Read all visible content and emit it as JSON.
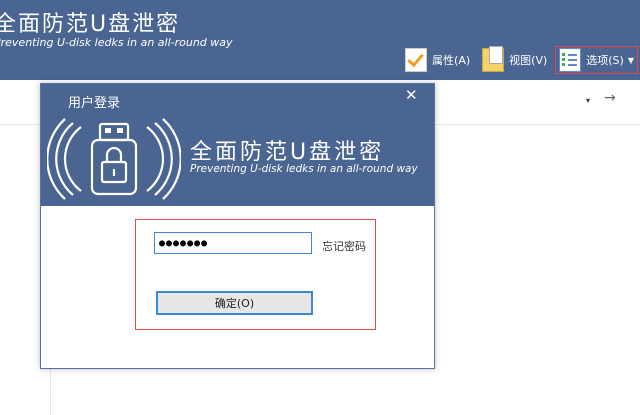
{
  "app": {
    "title": "全面防范U盘泄密",
    "subtitle": "Preventing U-disk ledks in an all-round way"
  },
  "toolbar": {
    "items": [
      {
        "label": "属性(A)",
        "icon": "checkmark-icon"
      },
      {
        "label": "视图(V)",
        "icon": "document-icon"
      },
      {
        "label": "选项(S)",
        "icon": "checklist-icon"
      }
    ]
  },
  "address_bar": {
    "dropdown_glyph": "▾",
    "forward_glyph": "→"
  },
  "dialog": {
    "title": "用户登录",
    "close_glyph": "✕",
    "brand_title": "全面防范U盘泄密",
    "brand_subtitle": "Preventing U-disk ledks in an all-round way",
    "password_value": "●●●●●●●",
    "forgot_label": "忘记密码",
    "ok_label": "确定(O)"
  },
  "colors": {
    "header_bg": "#4a6592",
    "highlight_border": "#e04848",
    "focus_blue": "#3d88d6"
  }
}
